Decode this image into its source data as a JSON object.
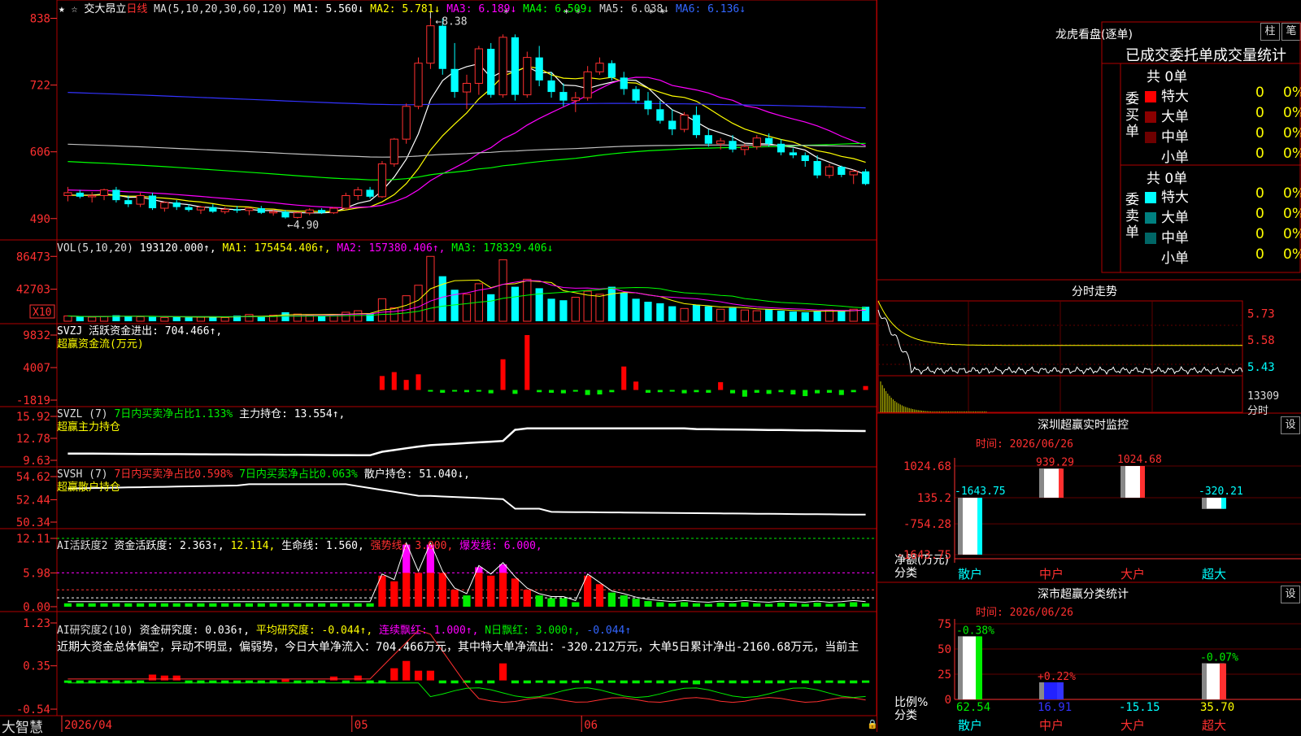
{
  "colors": {
    "up": "#ff3030",
    "down": "#00ffff",
    "ma1": "#ffffff",
    "ma2": "#ffff00",
    "ma3": "#ff00ff",
    "ma4": "#00ff00",
    "ma5": "#c0c0c0",
    "ma6": "#3333ff",
    "border": "#b00000",
    "green": "#00ee00",
    "magenta": "#ff00ff"
  },
  "header": {
    "stars": "★ ☆",
    "stock": "交大昂立",
    "period": "日线",
    "ma_spec": "MA(5,10,20,30,60,120)",
    "ma1": "MA1: 5.560↓",
    "ma2": "MA2: 5.781↓",
    "ma3": "MA3: 6.189↓",
    "ma4": "MA4: 6.509↓",
    "ma5": "MA5: 6.038↓",
    "ma6": "MA6: 6.136↓"
  },
  "price_panel": {
    "axis": [
      "838",
      "722",
      "606",
      "490"
    ],
    "high_label": "8.38",
    "low_label": "←4.90",
    "markers": [
      "*",
      "* *",
      "* *"
    ]
  },
  "vol_panel": {
    "title": "VOL(5,10,20)",
    "value": "193120.000↑,",
    "ma1": "MA1: 175454.406↑,",
    "ma2": "MA2: 157380.406↑,",
    "ma3": "MA3: 178329.406↓",
    "axis": [
      "86473",
      "42703"
    ],
    "unit": "X10"
  },
  "svzj_panel": {
    "title": "SVZJ  活跃资金进出: 704.466↑,",
    "subtitle": "超赢资金流(万元)",
    "axis": [
      "9832",
      "4007",
      "-1819"
    ]
  },
  "svzl_panel": {
    "title": "SVZL (7)",
    "part1": "7日内买卖净占比1.133%",
    "part2": "主力持仓: 13.554↑,",
    "subtitle": "超赢主力持仓",
    "axis": [
      "15.92",
      "12.78",
      "9.63"
    ]
  },
  "svsh_panel": {
    "title": "SVSH (7)",
    "part1": "7日内买卖净占比0.598%",
    "part2": "7日内买卖净占比0.063%",
    "part3": "散户持仓: 51.040↓,",
    "subtitle": "超赢散户持仓",
    "axis": [
      "54.62",
      "52.44",
      "50.34"
    ]
  },
  "ai1_panel": {
    "title": "AI活跃度2",
    "part1": "资金活跃度: 2.363↑,",
    "part2": "12.114,",
    "part3": "生命线: 1.560,",
    "part4": "强势线: 3.000,",
    "part5": "爆发线: 6.000,",
    "axis": [
      "12.11",
      "5.98",
      "0.00"
    ]
  },
  "ai2_panel": {
    "title": "AI研究度2(10)",
    "part1": "资金研究度: 0.036↑,",
    "part2": "平均研究度: -0.044↑,",
    "part3": "连续飘红: 1.000↑,",
    "part4": "N日飘红: 3.000↑,",
    "part5": "-0.044↑",
    "comment": "近期大资金总体偏空，异动不明显，偏弱势，今日大单净流入：704.466万元，其中特大单净流出：-320.212万元，大单5日累计净出-2160.68万元，当前主",
    "axis": [
      "1.23",
      "0.35",
      "-0.54"
    ]
  },
  "xaxis": {
    "brand": "大智慧",
    "labels": [
      "2026/04",
      "05",
      "06"
    ]
  },
  "longhu": {
    "title": "龙虎看盘(逐单)",
    "btn1": "柱",
    "btn2": "笔",
    "subtitle": "已成交委托单成交量统计",
    "buy_label": "委买单",
    "sell_label": "委卖单",
    "buy_total": "共 0单",
    "sell_total": "共 0单",
    "buy_rows": [
      {
        "name": "特大",
        "count": "0",
        "pct": "0%"
      },
      {
        "name": "大单",
        "count": "0",
        "pct": "0%"
      },
      {
        "name": "中单",
        "count": "0",
        "pct": "0%"
      },
      {
        "name": "小单",
        "count": "0",
        "pct": "0%"
      }
    ],
    "sell_rows": [
      {
        "name": "特大",
        "count": "0",
        "pct": "0%"
      },
      {
        "name": "大单",
        "count": "0",
        "pct": "0%"
      },
      {
        "name": "中单",
        "count": "0",
        "pct": "0%"
      },
      {
        "name": "小单",
        "count": "0",
        "pct": "0%"
      }
    ]
  },
  "intraday": {
    "title": "分时走势",
    "axis": [
      "5.73",
      "5.58",
      "5.43"
    ],
    "vol_label": "13309",
    "footer": "分时"
  },
  "monitor": {
    "title": "深圳超赢实时监控",
    "btn": "设",
    "time": "时间: 2026/06/26",
    "axis": [
      "1024.68",
      "135.2",
      "-754.28",
      "-1643.75"
    ],
    "unit": "净额(万元)",
    "unit2": "分类",
    "cats": [
      "散户",
      "中户",
      "大户",
      "超大"
    ],
    "values": [
      -1643.75,
      939.29,
      1024.68,
      -320.21
    ],
    "labels": [
      "-1643.75",
      "939.29",
      "1024.68",
      "-320.21"
    ]
  },
  "classify": {
    "title": "深市超赢分类统计",
    "btn": "设",
    "time": "时间: 2026/06/26",
    "axis": [
      "75",
      "50",
      "25",
      "0"
    ],
    "unit": "比例%",
    "unit2": "分类",
    "cats": [
      "散户",
      "中户",
      "大户",
      "超大"
    ],
    "bar_values": [
      62.54,
      16.91,
      0,
      35.7
    ],
    "bottom_labels": [
      "62.54",
      "16.91",
      "-15.15",
      "35.70"
    ],
    "top_labels": [
      "-0.38%",
      "+0.22%",
      "",
      "-0.07%"
    ]
  },
  "chart_data": [
    {
      "type": "candlestick",
      "title": "交大昂立 日线",
      "ylabel": "",
      "ylim": [
        4.6,
        8.5
      ],
      "x": [
        "2026/04",
        "05",
        "06"
      ],
      "ohlc": [
        [
          5.3,
          5.45,
          5.2,
          5.35
        ],
        [
          5.35,
          5.4,
          5.25,
          5.28
        ],
        [
          5.28,
          5.36,
          5.18,
          5.3
        ],
        [
          5.3,
          5.42,
          5.22,
          5.4
        ],
        [
          5.4,
          5.45,
          5.18,
          5.22
        ],
        [
          5.22,
          5.3,
          5.1,
          5.15
        ],
        [
          5.15,
          5.35,
          5.1,
          5.3
        ],
        [
          5.3,
          5.35,
          5.05,
          5.08
        ],
        [
          5.08,
          5.2,
          5.02,
          5.18
        ],
        [
          5.18,
          5.22,
          5.05,
          5.1
        ],
        [
          5.1,
          5.15,
          5.02,
          5.05
        ],
        [
          5.05,
          5.12,
          4.98,
          5.1
        ],
        [
          5.1,
          5.15,
          5.0,
          5.02
        ],
        [
          5.02,
          5.1,
          4.98,
          5.06
        ],
        [
          5.06,
          5.12,
          5.0,
          5.04
        ],
        [
          5.04,
          5.1,
          4.96,
          5.08
        ],
        [
          5.08,
          5.12,
          4.98,
          5.0
        ],
        [
          5.0,
          5.06,
          4.95,
          5.02
        ],
        [
          5.02,
          5.05,
          4.9,
          4.92
        ],
        [
          4.92,
          5.02,
          4.9,
          5.0
        ],
        [
          5.0,
          5.08,
          4.96,
          5.05
        ],
        [
          5.05,
          5.08,
          4.98,
          5.0
        ],
        [
          5.0,
          5.1,
          4.98,
          5.08
        ],
        [
          5.08,
          5.35,
          5.05,
          5.3
        ],
        [
          5.3,
          5.45,
          5.22,
          5.4
        ],
        [
          5.4,
          5.45,
          5.25,
          5.28
        ],
        [
          5.28,
          5.9,
          5.26,
          5.85
        ],
        [
          5.85,
          6.3,
          5.8,
          6.28
        ],
        [
          6.28,
          6.9,
          6.2,
          6.85
        ],
        [
          6.85,
          7.7,
          6.8,
          7.6
        ],
        [
          7.6,
          8.38,
          7.5,
          8.25
        ],
        [
          8.25,
          8.38,
          7.4,
          7.5
        ],
        [
          7.5,
          7.95,
          7.0,
          7.1
        ],
        [
          7.1,
          7.4,
          6.8,
          7.25
        ],
        [
          7.25,
          7.9,
          7.05,
          7.85
        ],
        [
          7.85,
          7.95,
          7.0,
          7.05
        ],
        [
          7.05,
          8.1,
          7.0,
          8.05
        ],
        [
          8.05,
          8.1,
          6.95,
          7.05
        ],
        [
          7.05,
          7.8,
          7.0,
          7.7
        ],
        [
          7.7,
          7.9,
          7.2,
          7.3
        ],
        [
          7.3,
          7.45,
          7.0,
          7.1
        ],
        [
          7.1,
          7.25,
          6.85,
          6.95
        ],
        [
          6.95,
          7.1,
          6.75,
          7.0
        ],
        [
          7.0,
          7.55,
          6.95,
          7.45
        ],
        [
          7.45,
          7.7,
          7.4,
          7.6
        ],
        [
          7.6,
          7.65,
          7.3,
          7.35
        ],
        [
          7.35,
          7.45,
          7.05,
          7.15
        ],
        [
          7.15,
          7.2,
          6.9,
          6.95
        ],
        [
          6.95,
          7.1,
          6.7,
          6.8
        ],
        [
          6.8,
          6.95,
          6.55,
          6.6
        ],
        [
          6.6,
          6.8,
          6.35,
          6.45
        ],
        [
          6.45,
          6.75,
          6.4,
          6.7
        ],
        [
          6.7,
          6.85,
          6.3,
          6.35
        ],
        [
          6.35,
          6.45,
          6.15,
          6.2
        ],
        [
          6.2,
          6.3,
          6.1,
          6.25
        ],
        [
          6.25,
          6.35,
          6.05,
          6.1
        ],
        [
          6.1,
          6.2,
          6.0,
          6.15
        ],
        [
          6.15,
          6.35,
          6.1,
          6.3
        ],
        [
          6.3,
          6.38,
          6.15,
          6.2
        ],
        [
          6.2,
          6.28,
          6.0,
          6.05
        ],
        [
          6.05,
          6.12,
          5.95,
          6.0
        ],
        [
          6.0,
          6.05,
          5.8,
          5.9
        ],
        [
          5.9,
          6.0,
          5.6,
          5.65
        ],
        [
          5.65,
          5.85,
          5.6,
          5.8
        ],
        [
          5.8,
          5.82,
          5.62,
          5.66
        ],
        [
          5.66,
          5.75,
          5.5,
          5.72
        ],
        [
          5.72,
          5.76,
          5.48,
          5.5
        ]
      ]
    },
    {
      "type": "bar",
      "title": "VOL(5,10,20)",
      "ylim": [
        0,
        90000
      ],
      "values": [
        7000,
        6000,
        5500,
        6500,
        8000,
        7000,
        6000,
        5800,
        5000,
        6200,
        5200,
        5500,
        6000,
        5000,
        7500,
        9000,
        6500,
        8000,
        12000,
        9500,
        8500,
        7000,
        9000,
        12000,
        14000,
        10000,
        30000,
        18000,
        34000,
        48000,
        86473,
        60000,
        42000,
        36000,
        50000,
        36000,
        82000,
        46000,
        56000,
        44000,
        30000,
        28000,
        32000,
        40000,
        36000,
        46000,
        38000,
        30000,
        26000,
        24000,
        20000,
        17000,
        22000,
        20000,
        16000,
        18000,
        15000,
        14000,
        16000,
        14000,
        13000,
        12000,
        13000,
        15000,
        14000,
        16000,
        19312
      ]
    },
    {
      "type": "bar",
      "title": "SVZJ 超赢资金流(万元)",
      "ylim": [
        -1819,
        9832
      ],
      "values": [
        0,
        0,
        0,
        0,
        0,
        0,
        0,
        0,
        0,
        0,
        0,
        0,
        0,
        0,
        0,
        0,
        0,
        0,
        0,
        0,
        0,
        0,
        0,
        0,
        0,
        0,
        2500,
        3200,
        1800,
        2800,
        -300,
        -500,
        -200,
        -400,
        -300,
        -600,
        5500,
        -700,
        9832,
        -400,
        -500,
        -600,
        -300,
        -900,
        -800,
        -400,
        4200,
        1500,
        -500,
        -400,
        -300,
        -600,
        -400,
        -500,
        1400,
        -600,
        -1200,
        -500,
        -700,
        -400,
        -800,
        -1100,
        -600,
        -500,
        -900,
        -400,
        704
      ]
    },
    {
      "type": "line",
      "title": "SVZL 超赢主力持仓",
      "ylim": [
        9.63,
        15.92
      ]
    },
    {
      "type": "line",
      "title": "SVSH 超赢散户持仓",
      "ylim": [
        50.34,
        54.62
      ]
    },
    {
      "type": "bar",
      "title": "AI活跃度2",
      "ylim": [
        0,
        12.11
      ]
    },
    {
      "type": "bar",
      "title": "AI研究度2(10)",
      "ylim": [
        -0.54,
        1.23
      ]
    }
  ]
}
